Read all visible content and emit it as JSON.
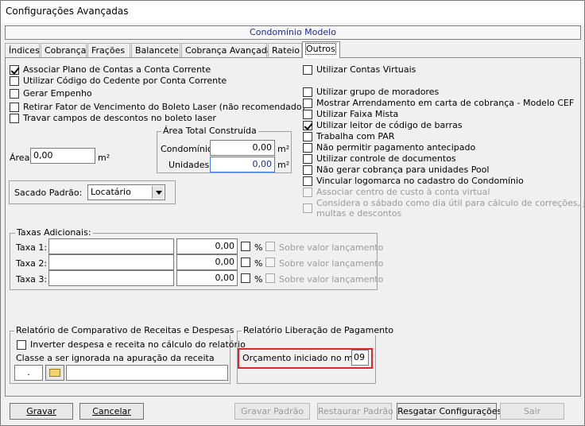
{
  "window": {
    "title": "Configurações Avançadas"
  },
  "header": {
    "subtitle": "Condomínio Modelo"
  },
  "tabs": [
    "Índices",
    "Cobrança",
    "Frações",
    "Balancete",
    "Cobrança Avançada",
    "Rateio",
    "Outros"
  ],
  "active_tab": "Outros",
  "left_options": [
    {
      "label": "Associar Plano de Contas a Conta Corrente",
      "checked": true
    },
    {
      "label": "Utilizar Código do Cedente por Conta Corrente",
      "checked": false
    },
    {
      "label": "Gerar Empenho",
      "checked": false
    },
    {
      "label": "Retirar Fator de Vencimento do Boleto Laser (não recomendado)",
      "checked": false
    },
    {
      "label": "Travar campos de descontos no boleto laser",
      "checked": false
    }
  ],
  "area": {
    "label": "Área:",
    "value": "0,00",
    "unit": "m²"
  },
  "area_total": {
    "title": "Área Total Construída",
    "condominio_label": "Condomínio:",
    "condominio_value": "0,00",
    "condominio_unit": "m²",
    "unidades_label": "Unidades:",
    "unidades_value": "0,00",
    "unidades_unit": "m²"
  },
  "sacado": {
    "label": "Sacado Padrão:",
    "value": "Locatário"
  },
  "right_options": [
    {
      "label": "Utilizar Contas Virtuais",
      "checked": false,
      "disabled": false
    },
    {
      "label": "Utilizar grupo de moradores",
      "checked": false,
      "disabled": false
    },
    {
      "label": "Mostrar Arrendamento em carta de cobrança - Modelo CEF",
      "checked": false,
      "disabled": false
    },
    {
      "label": "Utilizar Faixa Mista",
      "checked": false,
      "disabled": false
    },
    {
      "label": "Utilizar leitor de código de barras",
      "checked": true,
      "disabled": false
    },
    {
      "label": "Trabalha com PAR",
      "checked": false,
      "disabled": false
    },
    {
      "label": "Não permitir pagamento antecipado",
      "checked": false,
      "disabled": false
    },
    {
      "label": "Utilizar controle de documentos",
      "checked": false,
      "disabled": false
    },
    {
      "label": "Não gerar cobrança para unidades Pool",
      "checked": false,
      "disabled": false
    },
    {
      "label": "Vincular logomarca no cadastro do Condomínio",
      "checked": false,
      "disabled": false
    },
    {
      "label": "Associar centro de custo à conta virtual",
      "checked": false,
      "disabled": true
    },
    {
      "label": "Considera o sábado como dia útil para cálculo de correções, juros,",
      "label2": "multas e descontos",
      "checked": false,
      "disabled": true
    }
  ],
  "taxas": {
    "title": "Taxas Adicionais:",
    "rows": [
      {
        "label": "Taxa 1:",
        "name": "",
        "value": "0,00",
        "pct": "%",
        "sobre": "Sobre valor lançamento"
      },
      {
        "label": "Taxa 2:",
        "name": "",
        "value": "0,00",
        "pct": "%",
        "sobre": "Sobre valor lançamento"
      },
      {
        "label": "Taxa 3:",
        "name": "",
        "value": "0,00",
        "pct": "%",
        "sobre": "Sobre valor lançamento"
      }
    ]
  },
  "relatorio_comparativo": {
    "title": "Relatório de Comparativo de Receitas e Despesas",
    "invert_label": "Inverter despesa e receita no cálculo do relatório",
    "classe_label": "Classe a ser ignorada na apuração da receita",
    "classe_code": ".",
    "classe_desc": ""
  },
  "relatorio_liberacao": {
    "title": "Relatório Liberação de Pagamento",
    "orcamento_label": "Orçamento iniciado no mês:",
    "orcamento_value": "09"
  },
  "buttons": {
    "gravar": "Gravar",
    "cancelar": "Cancelar",
    "gravar_padrao": "Gravar Padrão",
    "restaurar_padrao": "Restaurar Padrão",
    "resgatar": "Resgatar Configurações",
    "sair": "Sair"
  }
}
